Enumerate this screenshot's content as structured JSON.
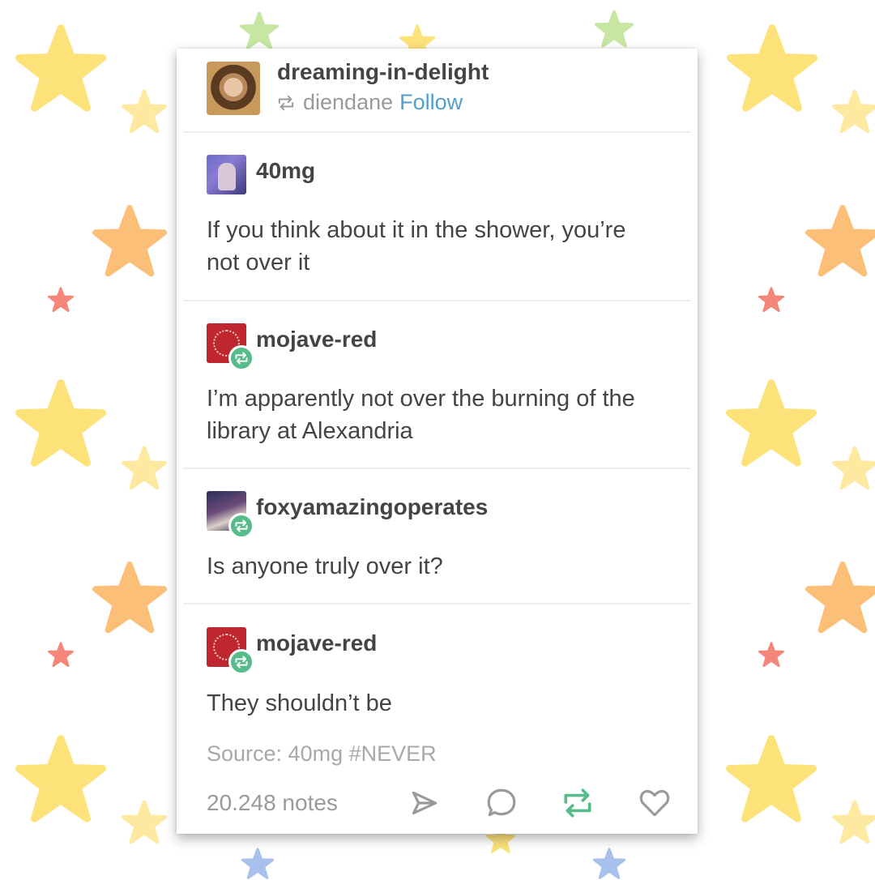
{
  "background": {
    "star_colors": {
      "yellow": "#fde27a",
      "light_yellow": "#fdeaa0",
      "orange": "#fbbf78",
      "red": "#f4877a",
      "green": "#c7e6a3",
      "blue": "#a7c1ec"
    }
  },
  "header": {
    "blog_name": "dreaming-in-delight",
    "reblogged_from": "diendane",
    "follow_label": "Follow",
    "follow_color": "#529ecc"
  },
  "thread": [
    {
      "username": "40mg",
      "text": "If you think about it in the shower, you’re not over it",
      "reblog": false
    },
    {
      "username": "mojave-red",
      "text": "I’m apparently not over the burning of the library at Alexandria",
      "reblog": true
    },
    {
      "username": "foxyamazingoperates",
      "text": "Is anyone truly over it?",
      "reblog": true
    },
    {
      "username": "mojave-red",
      "text": "They shouldn’t be",
      "reblog": true
    }
  ],
  "footer": {
    "source": "Source: 40mg #NEVER",
    "notes": "20.248 notes",
    "actions": [
      "share-icon",
      "comment-icon",
      "reblog-icon",
      "like-icon"
    ],
    "reblog_color": "#56bc8a"
  }
}
